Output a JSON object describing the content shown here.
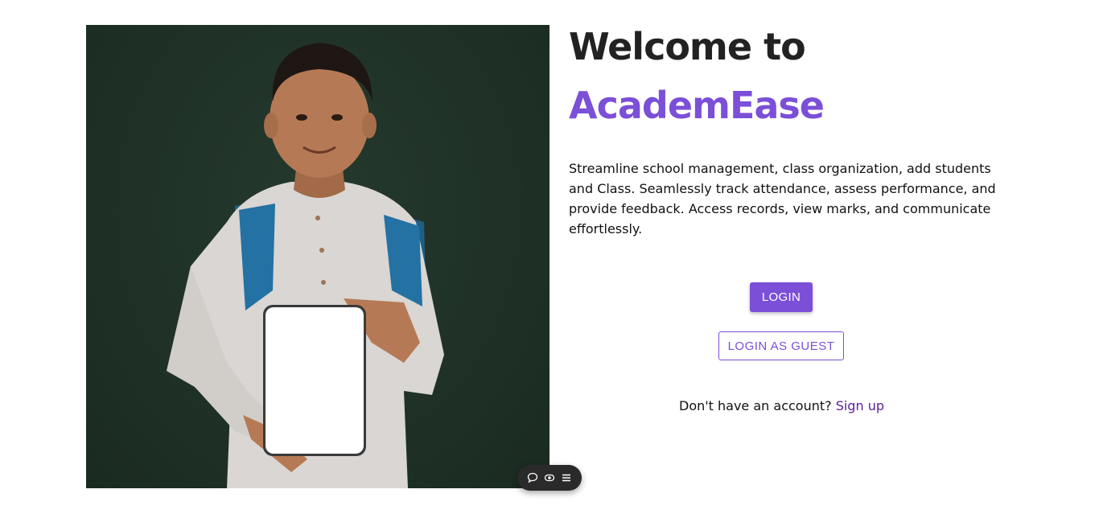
{
  "hero": {
    "image_alt": "Boy with backpack holding a tablet"
  },
  "welcome": {
    "line1": "Welcome to",
    "brand": "AcademEase"
  },
  "description": "Streamline school management, class organization, add students and Class. Seamlessly track attendance, assess performance, and provide feedback. Access records, view marks, and communicate effortlessly.",
  "buttons": {
    "login": "LOGIN",
    "guest": "LOGIN AS GUEST"
  },
  "signup": {
    "prompt": "Don't have an account? ",
    "link": "Sign up"
  },
  "floating_toolbar": {
    "icons": [
      "chat-bubble-icon",
      "eye-icon",
      "menu-icon"
    ]
  },
  "colors": {
    "accent": "#7b4fd8",
    "link": "#5b1e99",
    "heading": "#222222",
    "hero_bg": "#1f3127"
  }
}
